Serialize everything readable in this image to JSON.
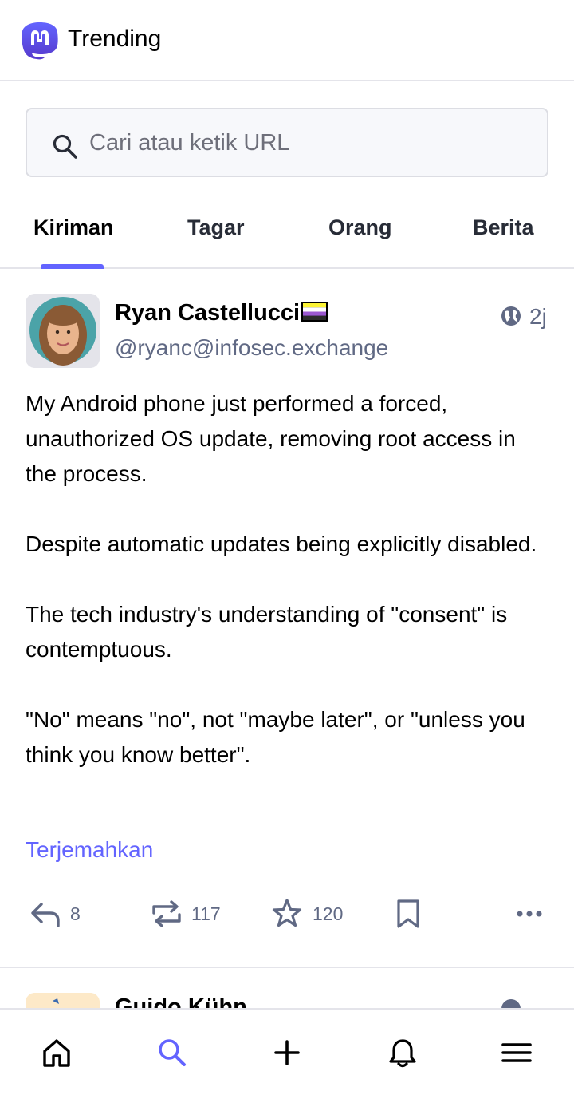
{
  "header": {
    "title": "Trending",
    "logo_icon": "mastodon-logo",
    "brand_color": "#6364ff"
  },
  "search": {
    "placeholder": "Cari atau ketik URL",
    "value": "",
    "icon": "search-icon"
  },
  "tabs": [
    {
      "label": "Kiriman",
      "active": true
    },
    {
      "label": "Tagar",
      "active": false
    },
    {
      "label": "Orang",
      "active": false
    },
    {
      "label": "Berita",
      "active": false
    }
  ],
  "post": {
    "author_name": "Ryan Castellucci",
    "author_handle": "@ryanc@infosec.exchange",
    "flag_icon": "nonbinary-flag-icon",
    "visibility_icon": "globe-icon",
    "time": "2j",
    "paragraphs": [
      "My Android phone just performed a forced, unauthorized OS update, removing root access in the process.",
      "Despite automatic updates being explicitly disabled.",
      "The tech industry's understanding of \"consent\" is contemptuous.",
      "\"No\" means \"no\", not \"maybe later\", or \"unless you think you know better\"."
    ],
    "translate_label": "Terjemahkan",
    "actions": {
      "reply_count": "8",
      "boost_count": "117",
      "favourite_count": "120"
    }
  },
  "next_post": {
    "author_name": "Guido Kühn"
  },
  "bottom_nav": {
    "items": [
      "home-icon",
      "search-icon",
      "compose-icon",
      "notifications-icon",
      "menu-icon"
    ],
    "active": "search-icon"
  },
  "colors": {
    "accent": "#6364ff",
    "muted_text": "#606984",
    "icon": "#282c37"
  }
}
